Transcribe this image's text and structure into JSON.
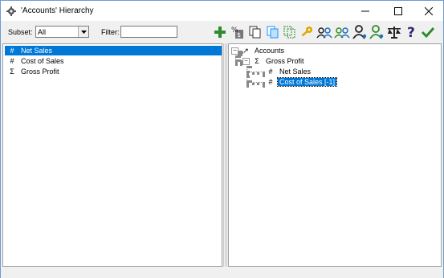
{
  "window": {
    "title": "'Accounts' Hierarchy",
    "title_icon": "gear-icon",
    "controls": [
      "minimize-icon",
      "maximize-icon",
      "close-icon"
    ]
  },
  "toolbar": {
    "subset_label": "Subset:",
    "subset_value": "All",
    "filter_label": "Filter:",
    "filter_value": "",
    "icons": [
      {
        "name": "add-element-icon",
        "color": "#2e8b2e"
      },
      {
        "name": "percent-element-icon",
        "color": "#555555"
      },
      {
        "name": "copy-icon",
        "color": "#333333"
      },
      {
        "name": "paste-icon",
        "color": "#1e90ff"
      },
      {
        "name": "dashed-copy-icon",
        "color": "#2e8b2e"
      },
      {
        "name": "key-icon",
        "color": "#e0a800"
      },
      {
        "name": "users-icon",
        "color": "#1e6fbf"
      },
      {
        "name": "users-green-icon",
        "color": "#2e8b2e"
      },
      {
        "name": "user-icon",
        "color": "#222222"
      },
      {
        "name": "user-add-icon",
        "color": "#2e8b2e"
      },
      {
        "name": "scale-icon",
        "color": "#222222"
      },
      {
        "name": "help-icon",
        "color": "#2b2b6b"
      },
      {
        "name": "checkmark-icon",
        "color": "#2e8b2e"
      }
    ]
  },
  "left_list": [
    {
      "glyph": "#",
      "label": "Net Sales",
      "selected": true
    },
    {
      "glyph": "#",
      "label": "Cost of Sales",
      "selected": false
    },
    {
      "glyph": "Σ",
      "label": "Gross Profit",
      "selected": false
    }
  ],
  "tree": {
    "root": {
      "glyph": "↗",
      "label": "Accounts",
      "expander": "−"
    },
    "child": {
      "glyph": "Σ",
      "label": "Gross Profit",
      "expander": "−"
    },
    "leaves": [
      {
        "glyph": "#",
        "label": "Net Sales",
        "selected": false
      },
      {
        "glyph": "#",
        "label": "Cost of Sales [-1]",
        "selected": true
      }
    ]
  },
  "colors": {
    "selection": "#0078d7",
    "accent_green": "#2e8b2e"
  }
}
